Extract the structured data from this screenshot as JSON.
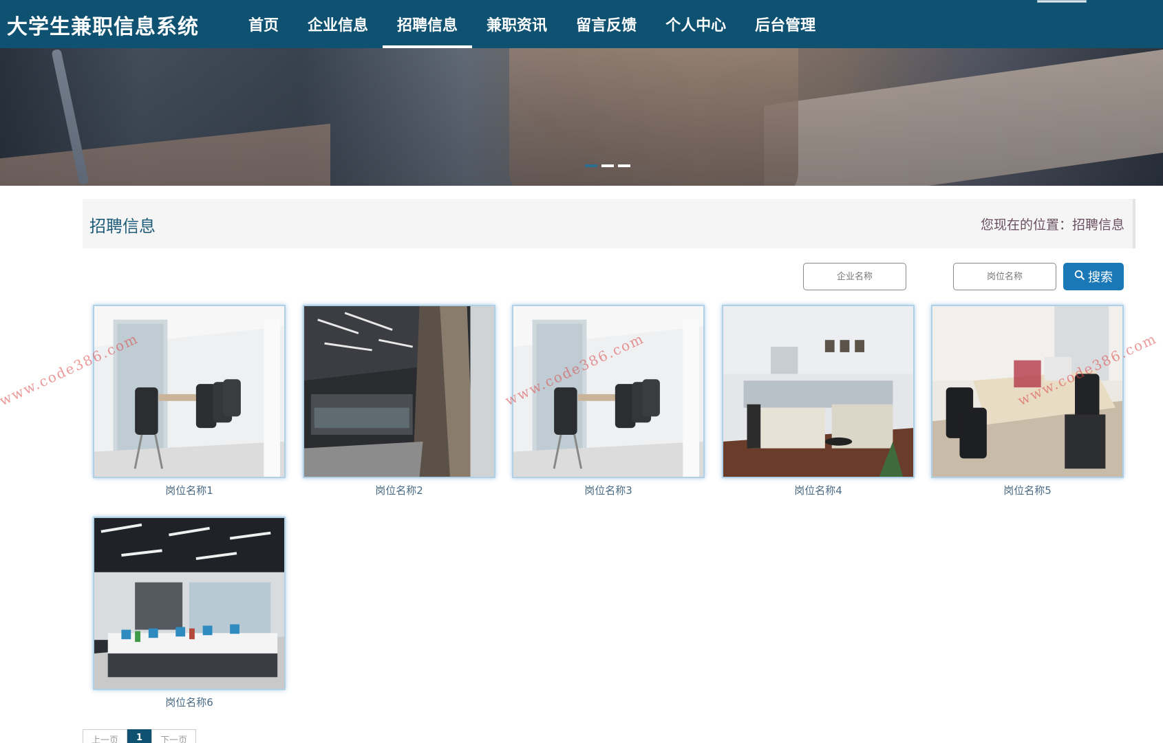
{
  "site": {
    "title": "大学生兼职信息系统"
  },
  "nav": {
    "items": [
      {
        "label": "首页",
        "active": false
      },
      {
        "label": "企业信息",
        "active": false
      },
      {
        "label": "招聘信息",
        "active": true
      },
      {
        "label": "兼职资讯",
        "active": false
      },
      {
        "label": "留言反馈",
        "active": false
      },
      {
        "label": "个人中心",
        "active": false
      },
      {
        "label": "后台管理",
        "active": false
      }
    ]
  },
  "banner": {
    "slide_count": 3,
    "active_slide": 1
  },
  "page": {
    "title": "招聘信息",
    "breadcrumb": "您现在的位置：招聘信息"
  },
  "search": {
    "company_placeholder": "企业名称",
    "position_placeholder": "岗位名称",
    "button_label": "搜索"
  },
  "jobs": [
    {
      "name": "岗位名称1",
      "image": "meeting-room-photo"
    },
    {
      "name": "岗位名称2",
      "image": "office-corridor-photo"
    },
    {
      "name": "岗位名称3",
      "image": "meeting-room-photo"
    },
    {
      "name": "岗位名称4",
      "image": "office-cubicles-photo"
    },
    {
      "name": "岗位名称5",
      "image": "office-desks-photo"
    },
    {
      "name": "岗位名称6",
      "image": "open-office-photo"
    }
  ],
  "watermark": "www.code386.com",
  "pagination": {
    "prev": "上一页",
    "current": "1",
    "next": "下一页"
  },
  "colors": {
    "header": "#0f5170",
    "accent": "#1a78b6",
    "watermark": "#dc4646"
  }
}
